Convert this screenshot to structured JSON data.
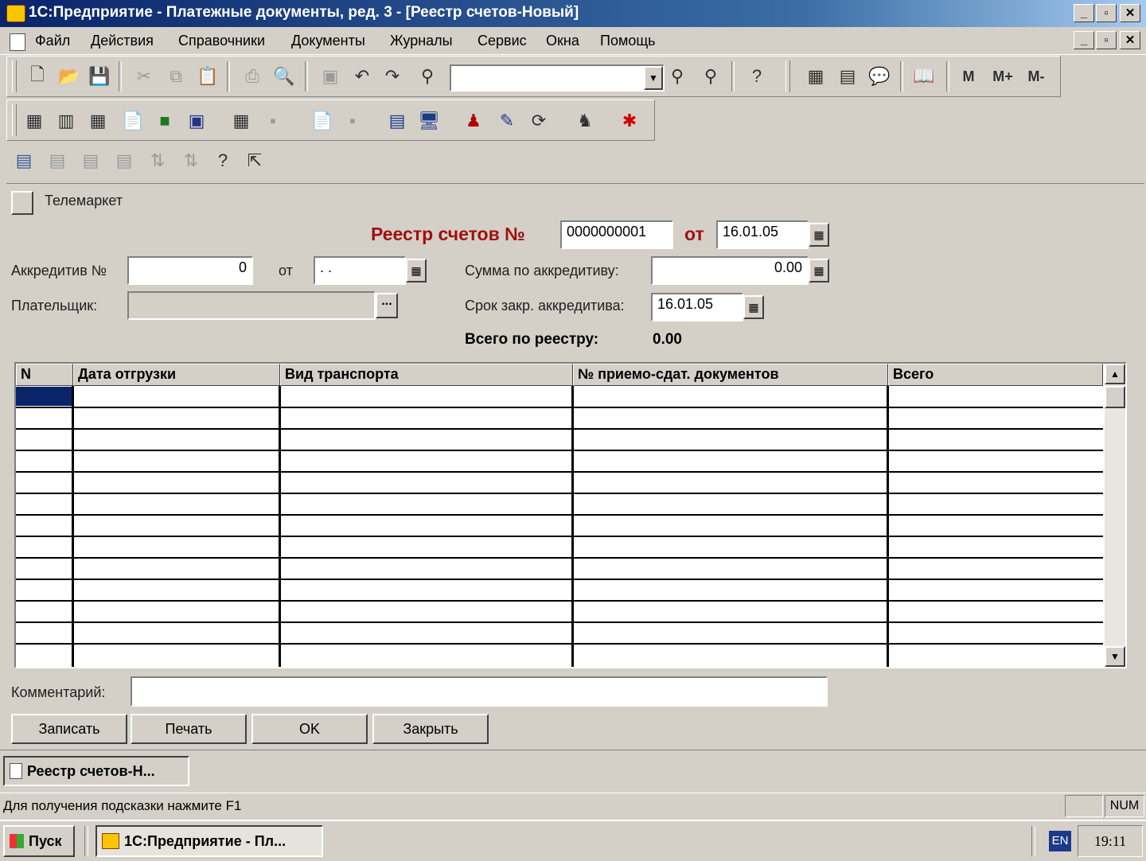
{
  "window": {
    "title": "1С:Предприятие - Платежные документы, ред. 3 - [Реестр счетов-Новый]",
    "buttons": [
      "_",
      "▫",
      "✕"
    ]
  },
  "menu": [
    "Файл",
    "Действия",
    "Справочники",
    "Документы",
    "Журналы",
    "Сервис",
    "Окна",
    "Помощь"
  ],
  "toolbar_memory": [
    "M",
    "M+",
    "M-"
  ],
  "form": {
    "company_button_label": "Телемаркет",
    "heading": "Реестр счетов №",
    "heading_from": "от",
    "doc_number": "0000000001",
    "doc_date": "16.01.05",
    "accreditive_label": "Аккредитив №",
    "accreditive_number": "0",
    "accreditive_from_label": "от",
    "accreditive_date": ". .",
    "payer_label": "Плательщик:",
    "payer_button": "...",
    "sum_label": "Сумма по аккредитиву:",
    "sum_value": "0.00",
    "close_term_label": "Срок закр. аккредитива:",
    "close_term_value": "16.01.05",
    "total_label": "Всего по реестру:",
    "total_value": "0.00",
    "comment_label": "Комментарий:",
    "comment_value": ""
  },
  "table": {
    "columns": [
      "N",
      "Дата отгрузки",
      "Вид транспорта",
      "№ приемо-сдат. документов",
      "Всего"
    ],
    "rows": []
  },
  "buttons": {
    "save": "Записать",
    "print": "Печать",
    "ok": "OK",
    "close": "Закрыть"
  },
  "mdi_tab": "Реестр счетов-Н...",
  "status": {
    "hint": "Для получения подсказки нажмите F1",
    "num": "NUM"
  },
  "taskbar": {
    "start": "Пуск",
    "app": "1С:Предприятие - Пл...",
    "lang": "EN",
    "clock": "19:11"
  }
}
